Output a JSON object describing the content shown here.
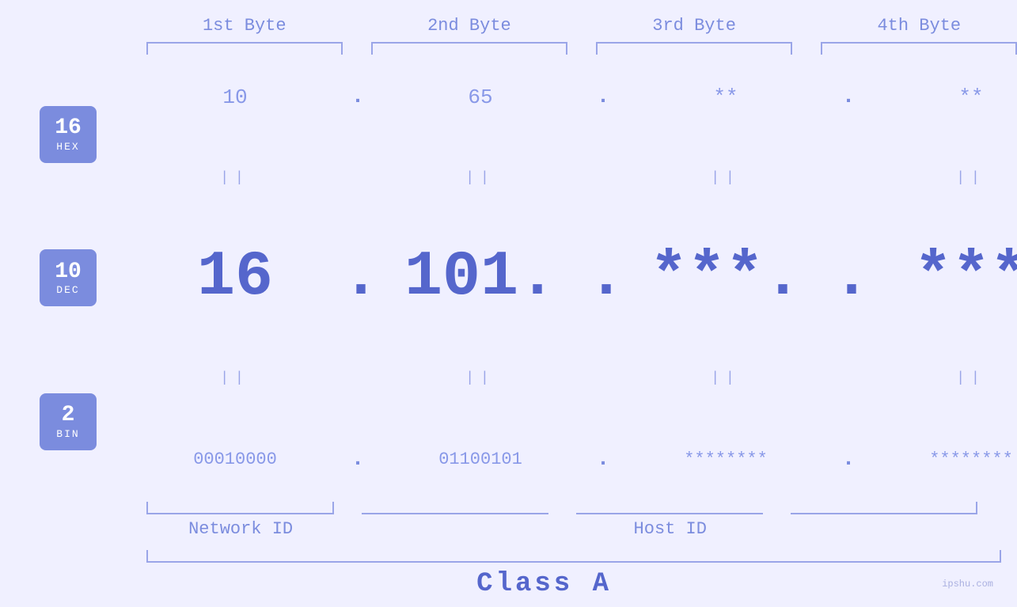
{
  "header": {
    "byte1": "1st Byte",
    "byte2": "2nd Byte",
    "byte3": "3rd Byte",
    "byte4": "4th Byte"
  },
  "badges": {
    "hex": {
      "num": "16",
      "label": "HEX"
    },
    "dec": {
      "num": "10",
      "label": "DEC"
    },
    "bin": {
      "num": "2",
      "label": "BIN"
    }
  },
  "hex_row": {
    "b1": "10",
    "b2": "65",
    "b3": "**",
    "b4": "**",
    "dot": "."
  },
  "dec_row": {
    "b1": "16",
    "b2": "101.",
    "b3": "***.",
    "b4": "***",
    "dot": "."
  },
  "bin_row": {
    "b1": "00010000",
    "b2": "01100101",
    "b3": "********",
    "b4": "********",
    "dot": "."
  },
  "labels": {
    "network_id": "Network ID",
    "host_id": "Host ID",
    "class": "Class A"
  },
  "watermark": "ipshu.com",
  "colors": {
    "accent": "#7b8cde",
    "light_accent": "#9aa5e8",
    "dark_accent": "#5566cc",
    "bg": "#f0f0ff"
  }
}
